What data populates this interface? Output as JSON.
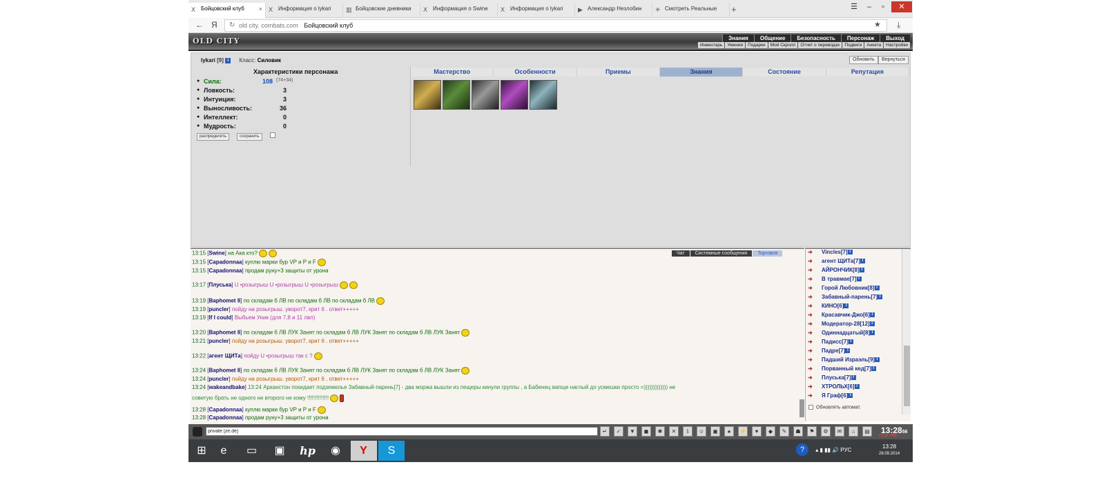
{
  "browser": {
    "tabs": [
      {
        "label": "Бойцовский клуб",
        "icon": "X"
      },
      {
        "label": "Информация о lykari",
        "icon": "X"
      },
      {
        "label": "Бойцовские дневники",
        "icon": "▥"
      },
      {
        "label": "Информация о Swine",
        "icon": "X"
      },
      {
        "label": "Информация о lykari",
        "icon": "X"
      },
      {
        "label": "Александр Незлобин",
        "icon": "▶"
      },
      {
        "label": "Смотреть Реальные",
        "icon": "✳"
      }
    ],
    "tab_close": "×",
    "new_tab": "+",
    "win_controls": {
      "menu": "☰",
      "min": "–",
      "max": "▫",
      "close": "✕"
    },
    "back": "←",
    "yandex_letter": "Я",
    "reload": "↻",
    "url_host": "old city. combats.com",
    "page_title": "Бойцовский клуб",
    "star": "★",
    "download": "⤓"
  },
  "game": {
    "logo": "OLD CITY",
    "main_nav": [
      "Знания",
      "Общение",
      "Безопасность",
      "Персонаж",
      "Выход"
    ],
    "sub_nav": [
      "Инвентарь",
      "Умения",
      "Подарки",
      "Мой Скролл",
      "Отчет о переводах",
      "Подвиги",
      "Анкета",
      "Настройки"
    ],
    "character": {
      "name": "lykari",
      "level": "[9]",
      "badge": "i",
      "class_label": "Класс:",
      "class_value": "Силовик",
      "refresh": "Обновить",
      "return": "Вернуться",
      "stats_header": "Характеристики персонажа",
      "bullet": "●",
      "stats": [
        {
          "name": "Сила:",
          "value": "108",
          "extra": "(74+34)"
        },
        {
          "name": "Ловкость:",
          "value": "3"
        },
        {
          "name": "Интуиция:",
          "value": "3"
        },
        {
          "name": "Выносливость:",
          "value": "36"
        },
        {
          "name": "Интеллект:",
          "value": "0"
        },
        {
          "name": "Мудрость:",
          "value": "0"
        }
      ],
      "btn_distribute": "распределить",
      "btn_save": "сохранить"
    },
    "char_tabs": [
      "Мастерство",
      "Особенности",
      "Приемы",
      "Знания",
      "Состояние",
      "Репутация"
    ],
    "active_char_tab": "Знания",
    "skill_icons": [
      "skill-gold-icon",
      "skill-green-icon",
      "skill-silver-icon",
      "skill-purple-icon",
      "skill-ice-icon"
    ]
  },
  "chat": {
    "tabs": [
      "Чат",
      "Системные сообщения",
      "Торговля"
    ],
    "lines": [
      {
        "time": "13:15",
        "nick": "Swine",
        "msg": "на Ака кто?",
        "cls": "m"
      },
      {
        "time": "13:15",
        "nick": "Capadonnaa",
        "msg": "куплю марки бур VP и P и F",
        "cls": "m"
      },
      {
        "time": "13:15",
        "nick": "Capadonnaa",
        "msg": "продам руну+3 защиты от урона",
        "cls": "m"
      },
      {
        "time": "13:17",
        "nick": "Плуська",
        "msg": "U •розыгрыш   U •розыгрыш   U •розыгрыш",
        "cls": "mp"
      },
      {
        "time": "13:19",
        "nick": "Baphomet II",
        "msg": "по складам б ЛВ     по складам б ЛВ     по складам б ЛВ",
        "cls": "m"
      },
      {
        "time": "13:19",
        "nick": "puncler",
        "msg": "пойду на розыгрыш. уворот7, крит 6 . ответ+++++",
        "cls": "mp"
      },
      {
        "time": "13:19",
        "nick": "If I could",
        "msg": "Выбьем Уник (для 7,8 и 11 лвл)",
        "cls": "mp"
      },
      {
        "time": "13:20",
        "nick": "Baphomet II",
        "msg": "по складам б ЛВ     ЛУК Занят по складам б ЛВ     ЛУК Занят по складам б ЛВ     ЛУК Занят",
        "cls": "m"
      },
      {
        "time": "13:21",
        "nick": "puncler",
        "msg": "пойду на розыгрыш. уворот7, крит 6 . ответ+++++",
        "cls": "mo"
      },
      {
        "time": "13:22",
        "nick": "агент ЩИТа",
        "msg": "пойду U •розыгрыш     так с ?",
        "cls": "mp"
      },
      {
        "time": "13:24",
        "nick": "Baphomet II",
        "msg": "по складам б ЛВ     ЛУК Занят по складам б ЛВ     ЛУК Занят по складам б ЛВ     ЛУК Занят",
        "cls": "m"
      },
      {
        "time": "13:24",
        "nick": "puncler",
        "msg": "пойду на розыгрыш. уворот7, крит 6 . ответ+++++",
        "cls": "mo"
      },
      {
        "time": "13:24",
        "nick": "wakeandbake",
        "msg": "13:24 Арканстон покидает подземелье Забавный-парень[7] - два моржа вышли из пещеры кинули группы , а Бабенец вапще наглый до усмешки просто =))))))))))))) не",
        "cls": "mg"
      },
      {
        "time": "",
        "nick": "",
        "msg": "советую брать не одного не второго не кому !!!!!!!!!!!!!!",
        "cls": "mg"
      },
      {
        "time": "13:28",
        "nick": "Capadonnaa",
        "msg": "куплю марки бур VP и P и F",
        "cls": "m"
      },
      {
        "time": "13:28",
        "nick": "Capadonnaa",
        "msg": "продам руну+3 защиты от урона",
        "cls": "m"
      }
    ],
    "input_value": "private [ze.de]",
    "toolbar_icons": [
      "↵",
      "✓",
      "▼",
      "◼",
      "✱",
      "✕",
      "⇩",
      "☺",
      "▣",
      "♠",
      "⚡",
      "♥",
      "◆",
      "✎",
      "☗",
      "⚑",
      "⚙",
      "✉",
      "⌂",
      "▤"
    ],
    "clock": "13:28",
    "clock_sec": "56",
    "clock_sub": "CLUB TIME"
  },
  "online": {
    "users": [
      {
        "name": "Vincles",
        "lvl": "[7]"
      },
      {
        "name": "агент ЩИТа",
        "lvl": "[7]"
      },
      {
        "name": "АЙРОНЧИК",
        "lvl": "[8]"
      },
      {
        "name": "В травмае",
        "lvl": "[7]"
      },
      {
        "name": "Горой Любовник",
        "lvl": "[8]"
      },
      {
        "name": "Забавный-парень",
        "lvl": "[7]"
      },
      {
        "name": "КИНО",
        "lvl": "[6]"
      },
      {
        "name": "Красавчик-Джо",
        "lvl": "[6]"
      },
      {
        "name": "Модератор-28",
        "lvl": "[12]"
      },
      {
        "name": "Одиннадцатый",
        "lvl": "[8]"
      },
      {
        "name": "Падисс",
        "lvl": "[7]"
      },
      {
        "name": "Падре",
        "lvl": "[7]"
      },
      {
        "name": "Падший Израэль",
        "lvl": "[9]"
      },
      {
        "name": "Порванный кед",
        "lvl": "[7]"
      },
      {
        "name": "Плуська",
        "lvl": "[7]"
      },
      {
        "name": "ХТРОЛЬХ",
        "lvl": "[6]"
      },
      {
        "name": "Я Граф",
        "lvl": "[6]"
      }
    ],
    "arrow": "➔",
    "auto_update": "Обновлять автомат."
  },
  "taskbar": {
    "apps": [
      {
        "name": "windows-start-icon",
        "glyph": "⊞"
      },
      {
        "name": "ie-icon",
        "glyph": "e"
      },
      {
        "name": "explorer-icon",
        "glyph": "▭"
      },
      {
        "name": "store-icon",
        "glyph": "▣"
      },
      {
        "name": "hp-icon",
        "glyph": "hp"
      },
      {
        "name": "chrome-icon",
        "glyph": "◉"
      },
      {
        "name": "yandex-icon",
        "glyph": "Y"
      },
      {
        "name": "skype-icon",
        "glyph": "S"
      }
    ],
    "help": "?",
    "tray": "▴  ▮  ▮▮  🔊  РУС",
    "time": "13:28",
    "date": "28.09.2014"
  }
}
